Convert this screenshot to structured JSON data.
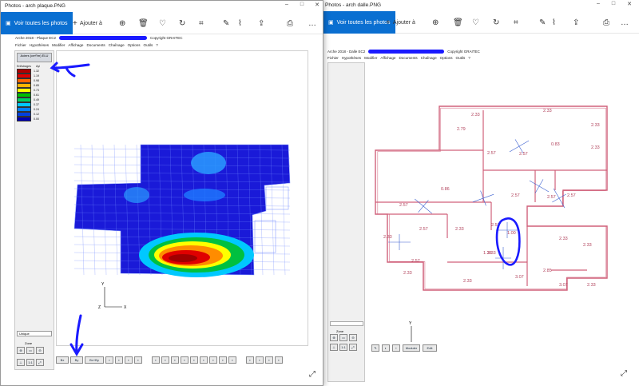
{
  "left_window": {
    "title": "Photos - arch plaque.PNG",
    "view_all": "Voir toutes les photos",
    "add_to": "Ajouter à",
    "app": {
      "doc_title": "Arche 2018 - Plaque EC2",
      "copyright": "Copyright GRAITEC",
      "menu": [
        "Fichier",
        "Hypothèses",
        "Modifier",
        "Affichage",
        "Documents",
        "Chaînage",
        "Options",
        "Outils",
        "?"
      ],
      "panel_header": "Aciers (cm²/m) ELU",
      "legend_head": "Enfistrages",
      "legend_unit": "Ayl",
      "legend_values": [
        "1.32",
        "1.19",
        "0.98",
        "0.85",
        "0.73",
        "0.61",
        "0.49",
        "0.37",
        "0.24",
        "0.12",
        "0.00"
      ],
      "unique_label": "Unique",
      "zone_label": "Zone",
      "unit_label": "1:1",
      "axis_y": "Y",
      "axis_z": "Z",
      "axis_x": "X",
      "bottom_labels": [
        "Bx",
        "By",
        "Bx+By"
      ]
    },
    "colors": {
      "legend": [
        "#b00000",
        "#e00000",
        "#ff6400",
        "#ffb400",
        "#ffff00",
        "#00c000",
        "#00d060",
        "#00c8ff",
        "#0080ff",
        "#0040e0",
        "#0000b0"
      ],
      "accent": "#0a6fd1",
      "mesh_fill": "#1a1ad8",
      "annotation": "#1a1aff"
    }
  },
  "right_window": {
    "title": "Photos - arch dalle.PNG",
    "view_all": "Voir toutes les photos",
    "add_to": "Ajouter à",
    "app": {
      "doc_title": "Arche 2018 - Dalle EC2",
      "copyright": "Copyright GRAITEC",
      "menu": [
        "Fichier",
        "Hypothèses",
        "Modifier",
        "Affichage",
        "Documents",
        "Chaînage",
        "Options",
        "Outils",
        "?"
      ],
      "bottom_labels": [
        "Moduler",
        "Edit"
      ],
      "axis_y": "Y",
      "axis_z": "Z",
      "axis_x": "X",
      "plan_values": [
        "2.33",
        "2.33",
        "2.33",
        "2.79",
        "0.83",
        "2.33",
        "2.57",
        "2.57",
        "0.86",
        "2.57",
        "2.57",
        "2.57",
        "2.57",
        "2.57",
        "2.33",
        "2.33",
        "2.57",
        "2.33",
        "2.57",
        "2.33",
        "1.38",
        "1.00",
        "2.33",
        "2.33",
        "3.07",
        "2.33",
        "3.07",
        "2.85",
        "2.33"
      ],
      "zone_label": "Zone"
    },
    "colors": {
      "outline": "#d0607a",
      "hatch": "#3a5fd0"
    }
  }
}
